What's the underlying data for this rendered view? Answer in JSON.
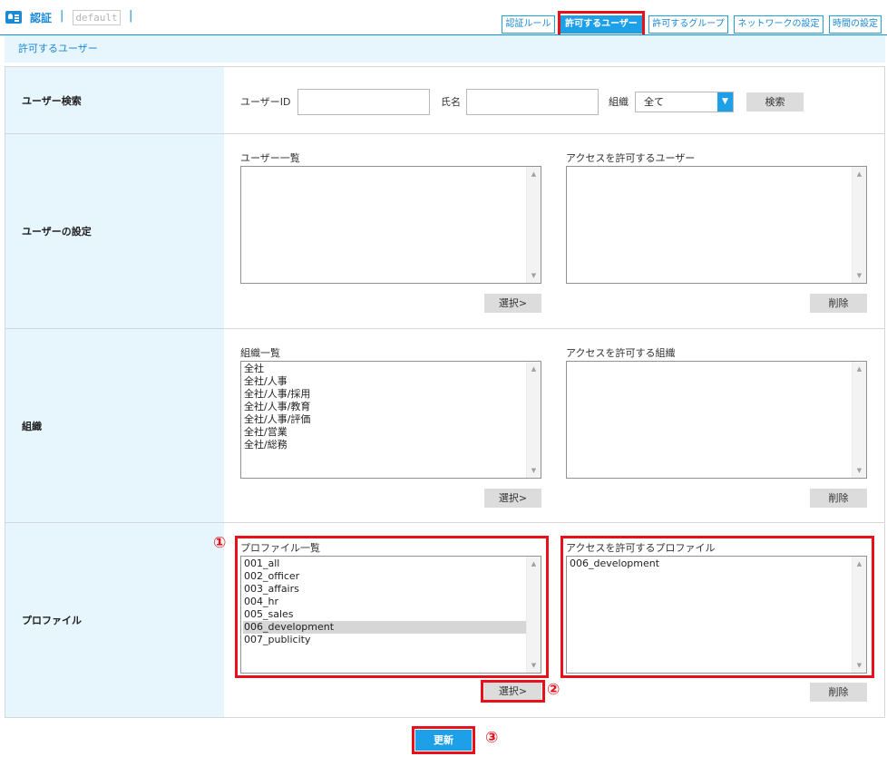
{
  "header": {
    "title": "認証",
    "separator": "|",
    "profile": "default"
  },
  "tabs": [
    {
      "label": "認証ルール",
      "active": false
    },
    {
      "label": "許可するユーザー",
      "active": true
    },
    {
      "label": "許可するグループ",
      "active": false
    },
    {
      "label": "ネットワークの設定",
      "active": false
    },
    {
      "label": "時間の設定",
      "active": false
    }
  ],
  "subheader": {
    "title": "許可するユーザー"
  },
  "search": {
    "label": "ユーザー検索",
    "user_id_label": "ユーザーID",
    "user_id_value": "",
    "name_label": "氏名",
    "name_value": "",
    "org_label": "組織",
    "org_selected": "全て",
    "search_button": "検索"
  },
  "user_settings": {
    "label": "ユーザーの設定",
    "list_title": "ユーザー一覧",
    "allowed_title": "アクセスを許可するユーザー",
    "list_items": [],
    "allowed_items": [],
    "select_button": "選択>",
    "delete_button": "削除"
  },
  "organization": {
    "label": "組織",
    "list_title": "組織一覧",
    "allowed_title": "アクセスを許可する組織",
    "list_items": [
      "全社",
      "全社/人事",
      "全社/人事/採用",
      "全社/人事/教育",
      "全社/人事/評価",
      "全社/営業",
      "全社/総務"
    ],
    "allowed_items": [],
    "select_button": "選択>",
    "delete_button": "削除"
  },
  "profile": {
    "label": "プロファイル",
    "list_title": "プロファイル一覧",
    "allowed_title": "アクセスを許可するプロファイル",
    "list_items": [
      "001_all",
      "002_officer",
      "003_affairs",
      "004_hr",
      "005_sales",
      "006_development",
      "007_publicity"
    ],
    "selected_index": 5,
    "allowed_items": [
      "006_development"
    ],
    "select_button": "選択>",
    "delete_button": "削除"
  },
  "footer": {
    "update_button": "更新"
  },
  "annotations": {
    "step1": "①",
    "step2": "②",
    "step3": "③"
  },
  "colors": {
    "accent": "#1ea0e8",
    "highlight": "#e8101a",
    "label_bg": "#e7f5fc"
  }
}
